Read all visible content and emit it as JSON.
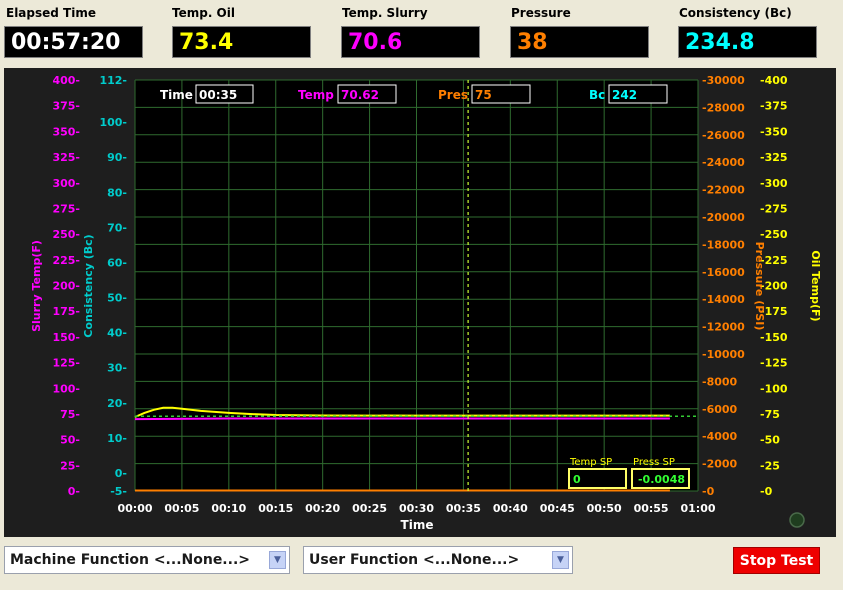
{
  "readouts": {
    "elapsed": {
      "label": "Elapsed Time",
      "value": "00:57:20",
      "color": "#ffffff"
    },
    "oil": {
      "label": "Temp. Oil",
      "value": "73.4",
      "color": "#ffff00"
    },
    "slurry": {
      "label": "Temp. Slurry",
      "value": "70.6",
      "color": "#ff00ff"
    },
    "pressure": {
      "label": "Pressure",
      "value": "38",
      "color": "#ff7f00"
    },
    "consistency": {
      "label": "Consistency (Bc)",
      "value": "234.8",
      "color": "#00ffff"
    }
  },
  "chart_header": {
    "time_label": "Time",
    "time_value": "00:35",
    "temp_label": "Temp",
    "temp_value": "70.62",
    "pres_label": "Pres",
    "pres_value": "75",
    "bc_label": "Bc",
    "bc_value": "242"
  },
  "setpoints": {
    "temp_label": "Temp SP",
    "temp_value": "0",
    "press_label": "Press SP",
    "press_value": "-0.0048"
  },
  "chart_data": {
    "type": "line",
    "xlabel": "Time",
    "x_ticks": [
      "00:00",
      "00:05",
      "00:10",
      "00:15",
      "00:20",
      "00:25",
      "00:30",
      "00:35",
      "00:40",
      "00:45",
      "00:50",
      "00:55",
      "01:00"
    ],
    "axes": {
      "slurry": {
        "label": "Slurry Temp(F)",
        "color": "#ff00ff",
        "ticks": [
          "400",
          "375",
          "350",
          "325",
          "300",
          "275",
          "250",
          "225",
          "200",
          "175",
          "150",
          "125",
          "100",
          "75",
          "50",
          "25",
          "0"
        ]
      },
      "consistency": {
        "label": "Consistency (Bc)",
        "color": "#00cccc",
        "ticks": [
          "112",
          "100",
          "90",
          "80",
          "70",
          "60",
          "50",
          "40",
          "30",
          "20",
          "10",
          "0",
          "-5"
        ]
      },
      "pressure": {
        "label": "Pressure (PSI)",
        "color": "#ff7f00",
        "ticks": [
          "30000",
          "28000",
          "26000",
          "24000",
          "22000",
          "20000",
          "18000",
          "16000",
          "14000",
          "12000",
          "10000",
          "8000",
          "6000",
          "4000",
          "2000",
          "0"
        ]
      },
      "oil": {
        "label": "Oil Temp(F)",
        "color": "#ffff00",
        "ticks": [
          "400",
          "375",
          "350",
          "325",
          "300",
          "275",
          "250",
          "225",
          "200",
          "175",
          "150",
          "125",
          "100",
          "75",
          "50",
          "25",
          "0"
        ]
      }
    },
    "xlim_minutes": [
      0,
      60
    ],
    "cursor_minute": 35.5,
    "series": [
      {
        "color": "#ffff00",
        "axis": "oil",
        "points": [
          [
            0,
            72
          ],
          [
            1,
            76
          ],
          [
            2,
            79
          ],
          [
            3,
            81
          ],
          [
            4,
            81
          ],
          [
            5,
            80
          ],
          [
            7,
            78
          ],
          [
            10,
            76
          ],
          [
            12,
            75
          ],
          [
            15,
            74
          ],
          [
            20,
            73.5
          ],
          [
            30,
            73.4
          ],
          [
            45,
            73.4
          ],
          [
            57,
            73.4
          ]
        ]
      },
      {
        "color": "#ff00ff",
        "axis": "slurry",
        "points": [
          [
            0,
            70
          ],
          [
            10,
            70.6
          ],
          [
            30,
            70.6
          ],
          [
            57,
            70.6
          ]
        ]
      },
      {
        "color": "#ff7f00",
        "axis": "pressure",
        "points": [
          [
            0,
            38
          ],
          [
            57,
            38
          ]
        ]
      },
      {
        "color": "#33cc33",
        "axis": "pressure",
        "dashed": true,
        "points": [
          [
            0,
            5450
          ],
          [
            60,
            5450
          ]
        ]
      }
    ]
  },
  "bottom": {
    "machine_function": "Machine Function <...None...>",
    "user_function": "User  Function <...None...>",
    "stop_label": "Stop Test"
  }
}
